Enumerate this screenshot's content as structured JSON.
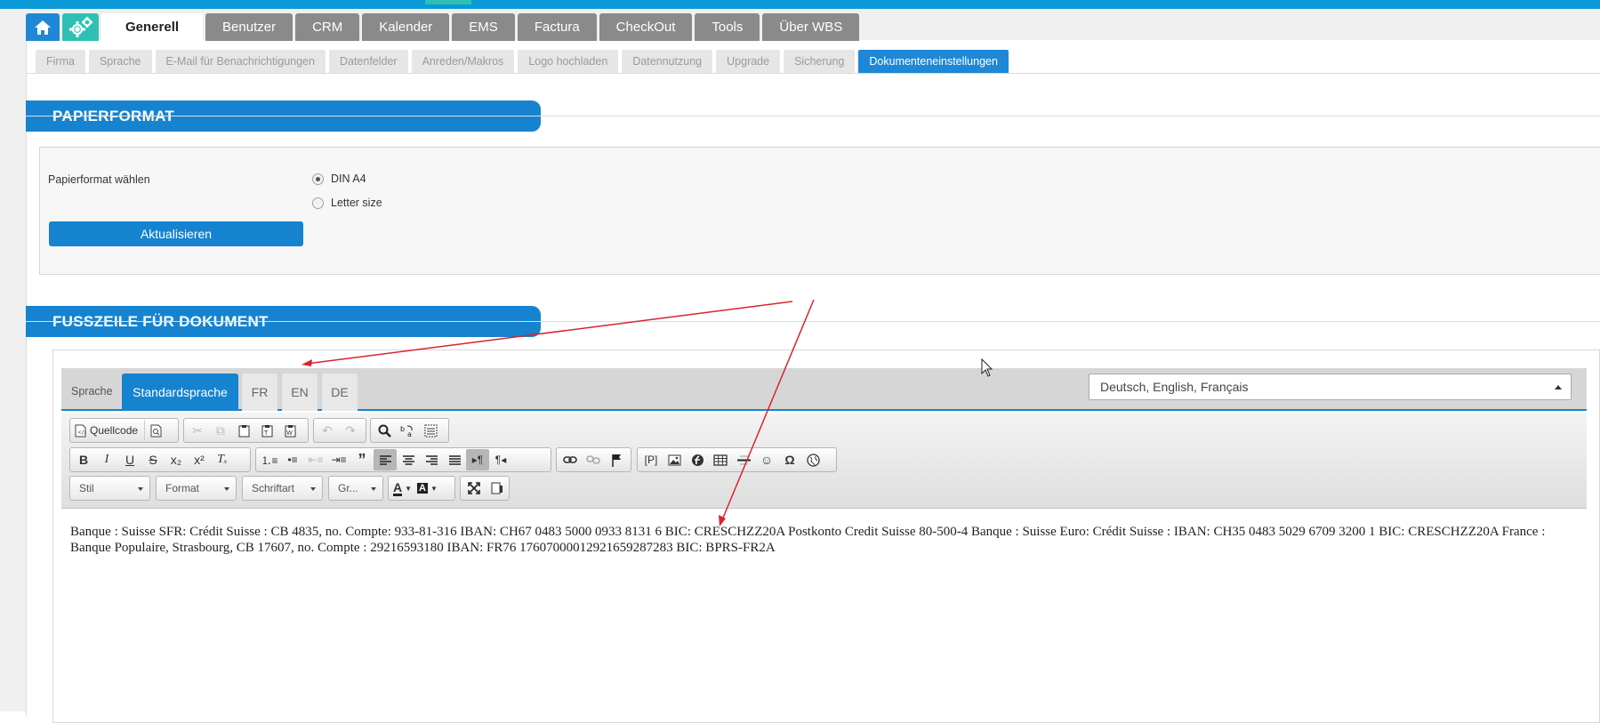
{
  "main_tabs": [
    {
      "label": "Generell",
      "active": true
    },
    {
      "label": "Benutzer"
    },
    {
      "label": "CRM"
    },
    {
      "label": "Kalender"
    },
    {
      "label": "EMS"
    },
    {
      "label": "Factura"
    },
    {
      "label": "CheckOut"
    },
    {
      "label": "Tools"
    },
    {
      "label": "Über WBS"
    }
  ],
  "sub_tabs": [
    {
      "label": "Firma"
    },
    {
      "label": "Sprache"
    },
    {
      "label": "E-Mail für Benachrichtigungen"
    },
    {
      "label": "Datenfelder"
    },
    {
      "label": "Anreden/Makros"
    },
    {
      "label": "Logo hochladen"
    },
    {
      "label": "Datennutzung"
    },
    {
      "label": "Upgrade"
    },
    {
      "label": "Sicherung"
    },
    {
      "label": "Dokumenteneinstellungen",
      "active": true
    }
  ],
  "paper_section": {
    "title": "PAPIERFORMAT",
    "field_label": "Papierformat wählen",
    "options": [
      {
        "label": "DIN A4",
        "checked": true
      },
      {
        "label": "Letter size",
        "checked": false
      }
    ],
    "button": "Aktualisieren"
  },
  "footer_section": {
    "title": "FUSSZEILE FÜR DOKUMENT",
    "language_label": "Sprache",
    "language_tabs": [
      {
        "label": "Standardsprache",
        "active": true
      },
      {
        "label": "FR"
      },
      {
        "label": "EN"
      },
      {
        "label": "DE"
      }
    ],
    "language_select": "Deutsch, English, Français"
  },
  "editor": {
    "source_label": "Quellcode",
    "combos": {
      "style": "Stil",
      "format": "Format",
      "font": "Schriftart",
      "size": "Gr..."
    },
    "content": "Banque : Suisse SFR: Crédit Suisse : CB 4835, no. Compte: 933-81-316 IBAN: CH67 0483 5000 0933 8131 6 BIC: CRESCHZZ20A Postkonto Credit Suisse 80-500-4 Banque : Suisse Euro: Crédit Suisse : IBAN: CH35 0483 5029 6709 3200 1 BIC: CRESCHZZ20A France : Banque Populaire, Strasbourg, CB 17607, no. Compte : 29216593180 IBAN: FR76 1760700001292165928728​3 BIC: BPRS-FR2A"
  },
  "colors": {
    "primary": "#1683d0",
    "teal": "#2ec0b3",
    "tab_grey": "#8a8a8a",
    "arrow": "#d9232e"
  }
}
